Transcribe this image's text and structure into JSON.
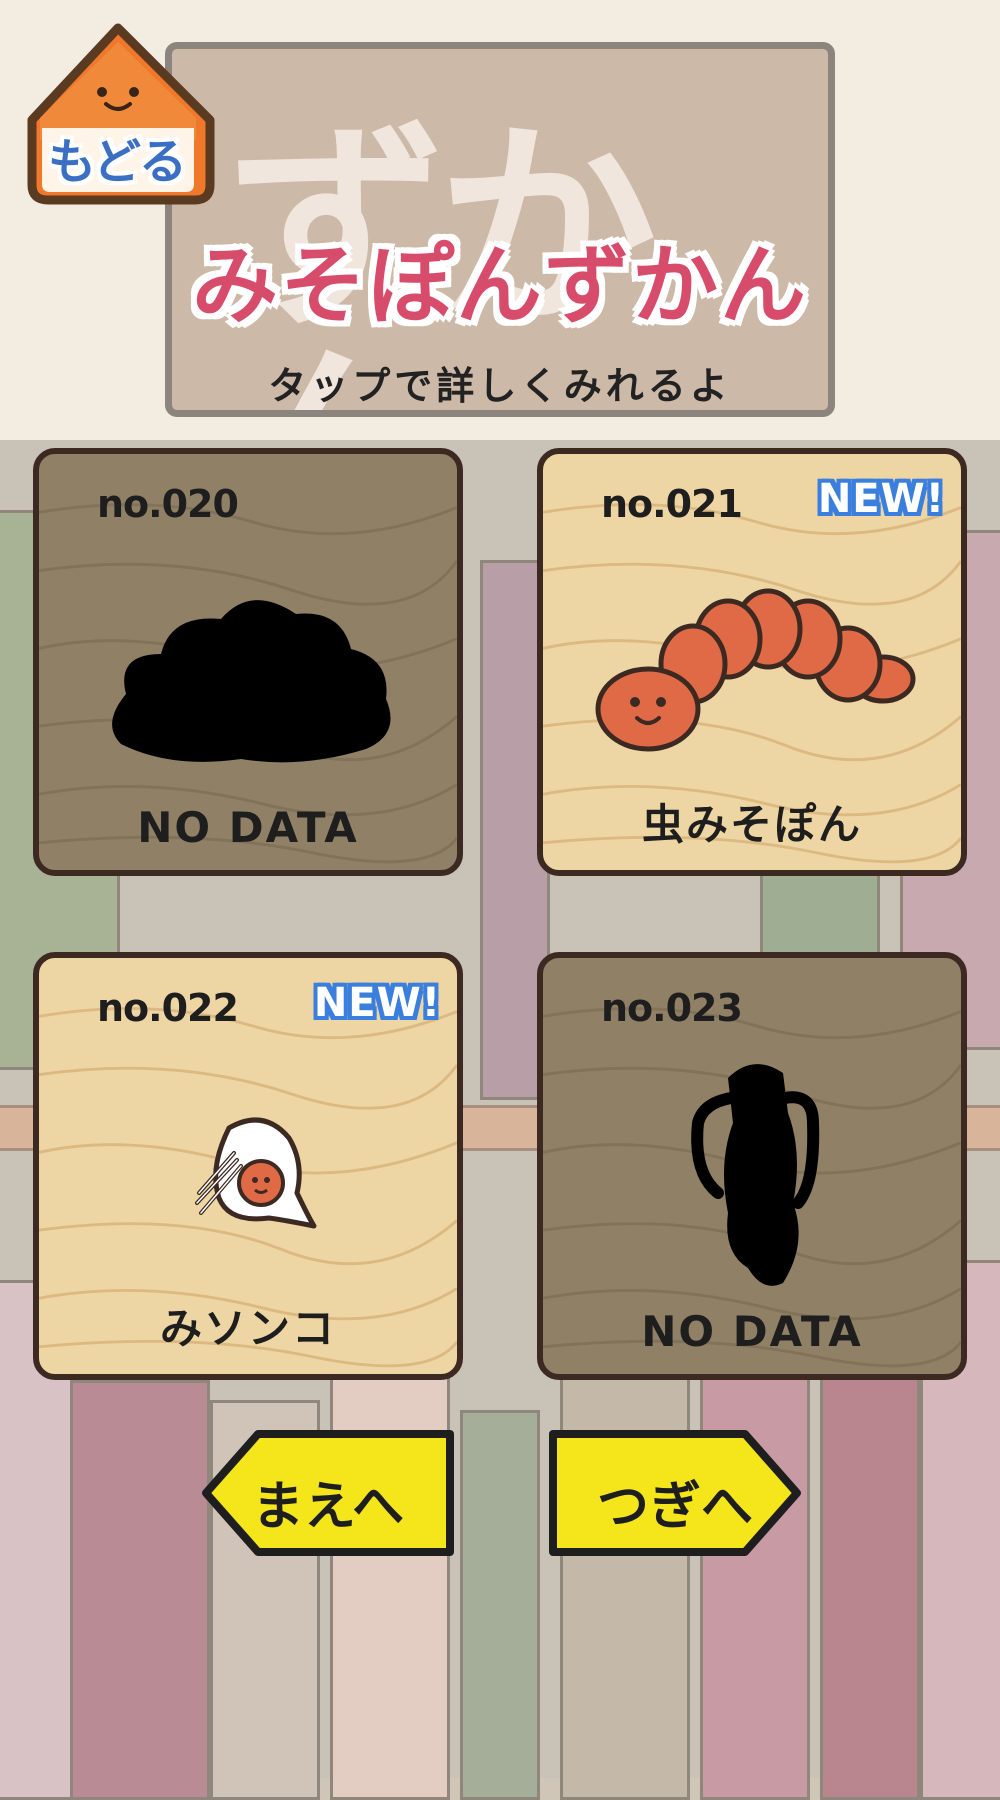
{
  "header": {
    "back_label": "もどる",
    "sign_ghost_text": "ずかん",
    "title": "みそぽんずかん",
    "subtitle": "タップで詳しくみれるよ"
  },
  "cards": [
    {
      "number": "no.020",
      "name": "NO DATA",
      "discovered": false,
      "new_badge": "",
      "art": "bush-silhouette"
    },
    {
      "number": "no.021",
      "name": "虫みそぽん",
      "discovered": true,
      "new_badge": "NEW!",
      "art": "worm-misopon"
    },
    {
      "number": "no.022",
      "name": "みソンコ",
      "discovered": true,
      "new_badge": "NEW!",
      "art": "white-hooded-misopon"
    },
    {
      "number": "no.023",
      "name": "NO DATA",
      "discovered": false,
      "new_badge": "",
      "art": "squid-silhouette"
    }
  ],
  "navigation": {
    "prev_label": "まえへ",
    "next_label": "つぎへ"
  },
  "colors": {
    "title_pink": "#d84c6b",
    "nav_yellow": "#f5e61c",
    "new_badge_blue": "#3a7fde",
    "worm_orange": "#e06a45",
    "back_arrow_orange": "#f0782a"
  }
}
